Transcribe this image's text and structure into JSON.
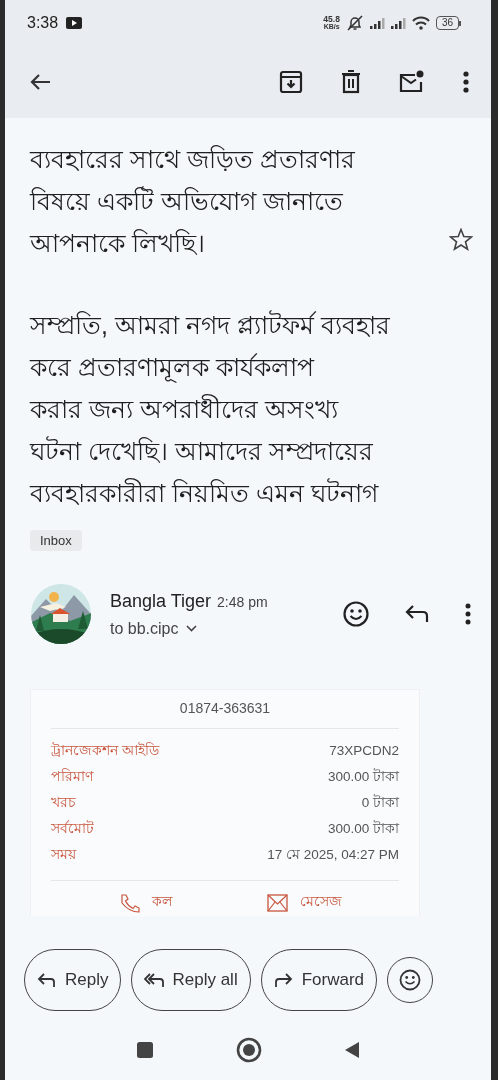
{
  "status_bar": {
    "time": "3:38",
    "speed_value": "45.8",
    "speed_unit": "KB/s",
    "battery": "36"
  },
  "body": {
    "paragraphs": [
      [
        "ব্যবহারের সাথে জড়িত প্রতারণার",
        "বিষয়ে একটি অভিযোগ জানাতে",
        "আপনাকে লিখছি।"
      ],
      [
        "সম্প্রতি, আমরা নগদ প্ল্যাটফর্ম ব্যবহার",
        "করে প্রতারণামূলক কার্যকলাপ",
        "করার জন্য অপরাধীদের অসংখ্য",
        "ঘটনা দেখেছি। আমাদের সম্প্রদায়ের",
        "ব্যবহারকারীরা নিয়মিত এমন ঘটনাগ"
      ]
    ],
    "starred": false,
    "label": "Inbox"
  },
  "message": {
    "sender": "Bangla Tiger",
    "time": "2:48 pm",
    "recipient": "to bb.cipc"
  },
  "receipt": {
    "phone": "01874-363631",
    "rows": [
      {
        "label": "ট্রানজেকশন আইডি",
        "value": "73XPCDN2"
      },
      {
        "label": "পরিমাণ",
        "value": "300.00 টাকা"
      },
      {
        "label": "খরচ",
        "value": "0 টাকা"
      },
      {
        "label": "সর্বমোট",
        "value": "300.00 টাকা"
      },
      {
        "label": "সময়",
        "value": "17 মে 2025, 04:27 PM"
      }
    ],
    "actions": [
      {
        "kind": "call",
        "label": "কল"
      },
      {
        "kind": "message",
        "label": "মেসেজ"
      }
    ]
  },
  "buttons": [
    {
      "kind": "reply",
      "label": "Reply"
    },
    {
      "kind": "reply_all",
      "label": "Reply all"
    },
    {
      "kind": "forward",
      "label": "Forward"
    }
  ]
}
